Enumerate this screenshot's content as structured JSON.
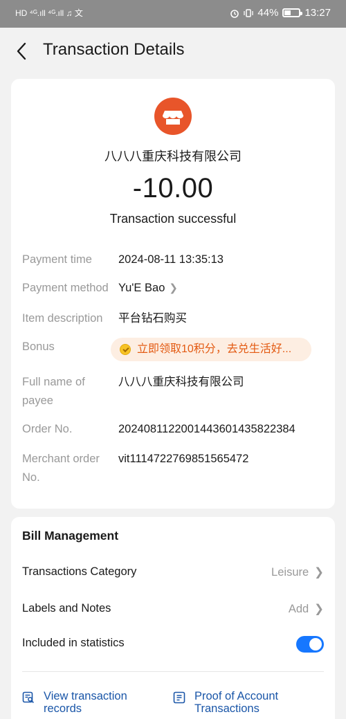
{
  "status_bar": {
    "left_icons": "HD ⁴ᴳ.ıll ⁴ᴳ.ıll ♫ 文",
    "battery_percent": "44%",
    "battery_level": 0.44,
    "time": "13:27"
  },
  "header": {
    "back_icon": "chevron-left-icon",
    "title": "Transaction Details"
  },
  "summary": {
    "merchant_icon": "storefront-icon",
    "merchant_icon_color": "#e8552a",
    "merchant_name": "八八八重庆科技有限公司",
    "amount": "-10.00",
    "status": "Transaction successful"
  },
  "details": [
    {
      "label": "Payment time",
      "value": "2024-08-11 13:35:13"
    },
    {
      "label": "Payment method",
      "value": "Yu'E Bao"
    },
    {
      "label": "Item description",
      "value": "平台钻石购买"
    },
    {
      "label": "Bonus",
      "value": "立即领取10积分，去兑生活好..."
    },
    {
      "label": "Full name of payee",
      "value": "八八八重庆科技有限公司"
    },
    {
      "label": "Order No.",
      "value": "2024081122001443601435822384"
    },
    {
      "label": "Merchant order No.",
      "value": "vit1114722769851565472"
    }
  ],
  "bill_management": {
    "title": "Bill Management",
    "category_label": "Transactions Category",
    "category_value": "Leisure",
    "labels_label": "Labels and Notes",
    "labels_value": "Add",
    "stats_label": "Included in statistics",
    "stats_enabled": true,
    "accent": "#1677ff",
    "link1": "View transaction records",
    "link2": "Proof of Account Transactions"
  }
}
